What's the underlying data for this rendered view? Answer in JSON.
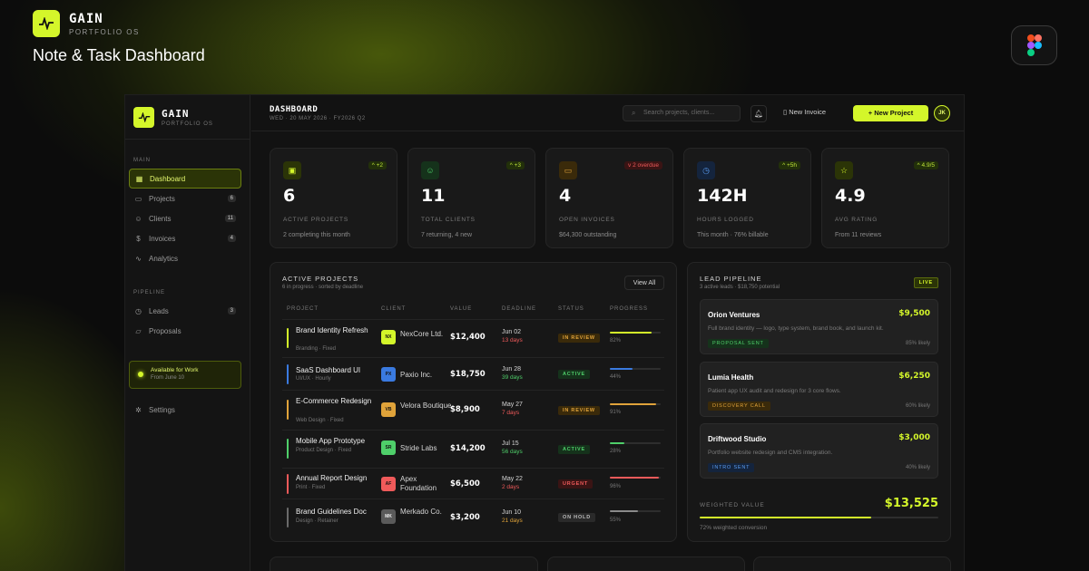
{
  "banner": {
    "brand": "GAIN",
    "brand_sub": "PORTFOLIO OS",
    "headline": "Note & Task Dashboard",
    "figma_icon": "figma-icon"
  },
  "sidebar": {
    "brand": "GAIN",
    "brand_sub": "PORTFOLIO OS",
    "main_label": "MAIN",
    "main_items": [
      {
        "label": "Dashboard",
        "icon": "grid-icon"
      },
      {
        "label": "Projects",
        "icon": "folder-icon",
        "count": "6"
      },
      {
        "label": "Clients",
        "icon": "users-icon",
        "count": "11"
      },
      {
        "label": "Invoices",
        "icon": "dollar-icon",
        "count": "4"
      },
      {
        "label": "Analytics",
        "icon": "pulse-icon"
      }
    ],
    "pipeline_label": "PIPELINE",
    "pipeline_items": [
      {
        "label": "Leads",
        "icon": "clock-icon",
        "count": "3"
      },
      {
        "label": "Proposals",
        "icon": "chat-icon"
      }
    ],
    "availability": {
      "title": "Available for Work",
      "subtitle": "From June 10"
    },
    "settings": "Settings"
  },
  "topbar": {
    "title": "DASHBOARD",
    "date": "WED · 20 MAY 2026 · FY2026 Q2",
    "search_placeholder": "Search projects, clients...",
    "new_invoice": "New Invoice",
    "new_project": "+ New Project",
    "avatar": "JK"
  },
  "stats": [
    {
      "value": "6",
      "label": "ACTIVE PROJECTS",
      "sub": "2 completing this month",
      "change": "^ +2",
      "icon": "briefcase-icon"
    },
    {
      "value": "11",
      "label": "TOTAL CLIENTS",
      "sub": "7 returning, 4 new",
      "change": "^ +3",
      "icon": "user-icon"
    },
    {
      "value": "4",
      "label": "OPEN INVOICES",
      "sub": "$64,300 outstanding",
      "change": "v 2 overdue",
      "icon": "card-icon"
    },
    {
      "value": "142H",
      "label": "HOURS LOGGED",
      "sub": "This month · 76% billable",
      "change": "^ +5h",
      "icon": "clock-icon"
    },
    {
      "value": "4.9",
      "label": "AVG RATING",
      "sub": "From 11 reviews",
      "change": "^ 4.9/5",
      "icon": "star-icon"
    }
  ],
  "projects": {
    "title": "ACTIVE PROJECTS",
    "subtitle": "6 in progress · sorted by deadline",
    "view_all": "View All",
    "headers": [
      "PROJECT",
      "CLIENT",
      "VALUE",
      "DEADLINE",
      "STATUS",
      "PROGRESS"
    ],
    "rows": [
      {
        "name": "Brand Identity Refresh",
        "cat": "Branding · Fixed",
        "ci": "NX",
        "client": "NexCore Ltd.",
        "value": "$12,400",
        "date": "Jun 02",
        "days": "13 days",
        "status": "IN REVIEW",
        "progress": "82%",
        "pct": 82
      },
      {
        "name": "SaaS Dashboard UI",
        "cat": "UI/UX · Hourly",
        "ci": "PX",
        "client": "Paxio Inc.",
        "value": "$18,750",
        "date": "Jun 28",
        "days": "39 days",
        "status": "ACTIVE",
        "progress": "44%",
        "pct": 44
      },
      {
        "name": "E-Commerce Redesign",
        "cat": "Web Design · Fixed",
        "ci": "VB",
        "client": "Velora Boutique",
        "value": "$8,900",
        "date": "May 27",
        "days": "7 days",
        "status": "IN REVIEW",
        "progress": "91%",
        "pct": 91
      },
      {
        "name": "Mobile App Prototype",
        "cat": "Product Design · Fixed",
        "ci": "SR",
        "client": "Stride Labs",
        "value": "$14,200",
        "date": "Jul 15",
        "days": "56 days",
        "status": "ACTIVE",
        "progress": "28%",
        "pct": 28
      },
      {
        "name": "Annual Report Design",
        "cat": "Print · Fixed",
        "ci": "AF",
        "client": "Apex Foundation",
        "value": "$6,500",
        "date": "May 22",
        "days": "2 days",
        "status": "URGENT",
        "progress": "96%",
        "pct": 96
      },
      {
        "name": "Brand Guidelines Doc",
        "cat": "Design · Retainer",
        "ci": "MK",
        "client": "Merkado Co.",
        "value": "$3,200",
        "date": "Jun 10",
        "days": "21 days",
        "status": "ON HOLD",
        "progress": "55%",
        "pct": 55
      }
    ]
  },
  "leads": {
    "title": "LEAD PIPELINE",
    "subtitle": "3 active leads · $18,750 potential",
    "badge": "LIVE",
    "items": [
      {
        "name": "Orion Ventures",
        "value": "$9,500",
        "desc": "Full brand identity — logo, type system, brand book, and launch kit.",
        "tag": "PROPOSAL SENT",
        "likely": "85% likely"
      },
      {
        "name": "Lumia Health",
        "value": "$6,250",
        "desc": "Patient app UX audit and redesign for 3 core flows.",
        "tag": "DISCOVERY CALL",
        "likely": "60% likely"
      },
      {
        "name": "Driftwood Studio",
        "value": "$3,000",
        "desc": "Portfolio website redesign and CMS integration.",
        "tag": "INTRO SENT",
        "likely": "40% likely"
      }
    ],
    "weighted_label": "WEIGHTED VALUE",
    "weighted_value": "$13,525",
    "conversion": "72% weighted conversion",
    "conversion_pct": 72
  }
}
